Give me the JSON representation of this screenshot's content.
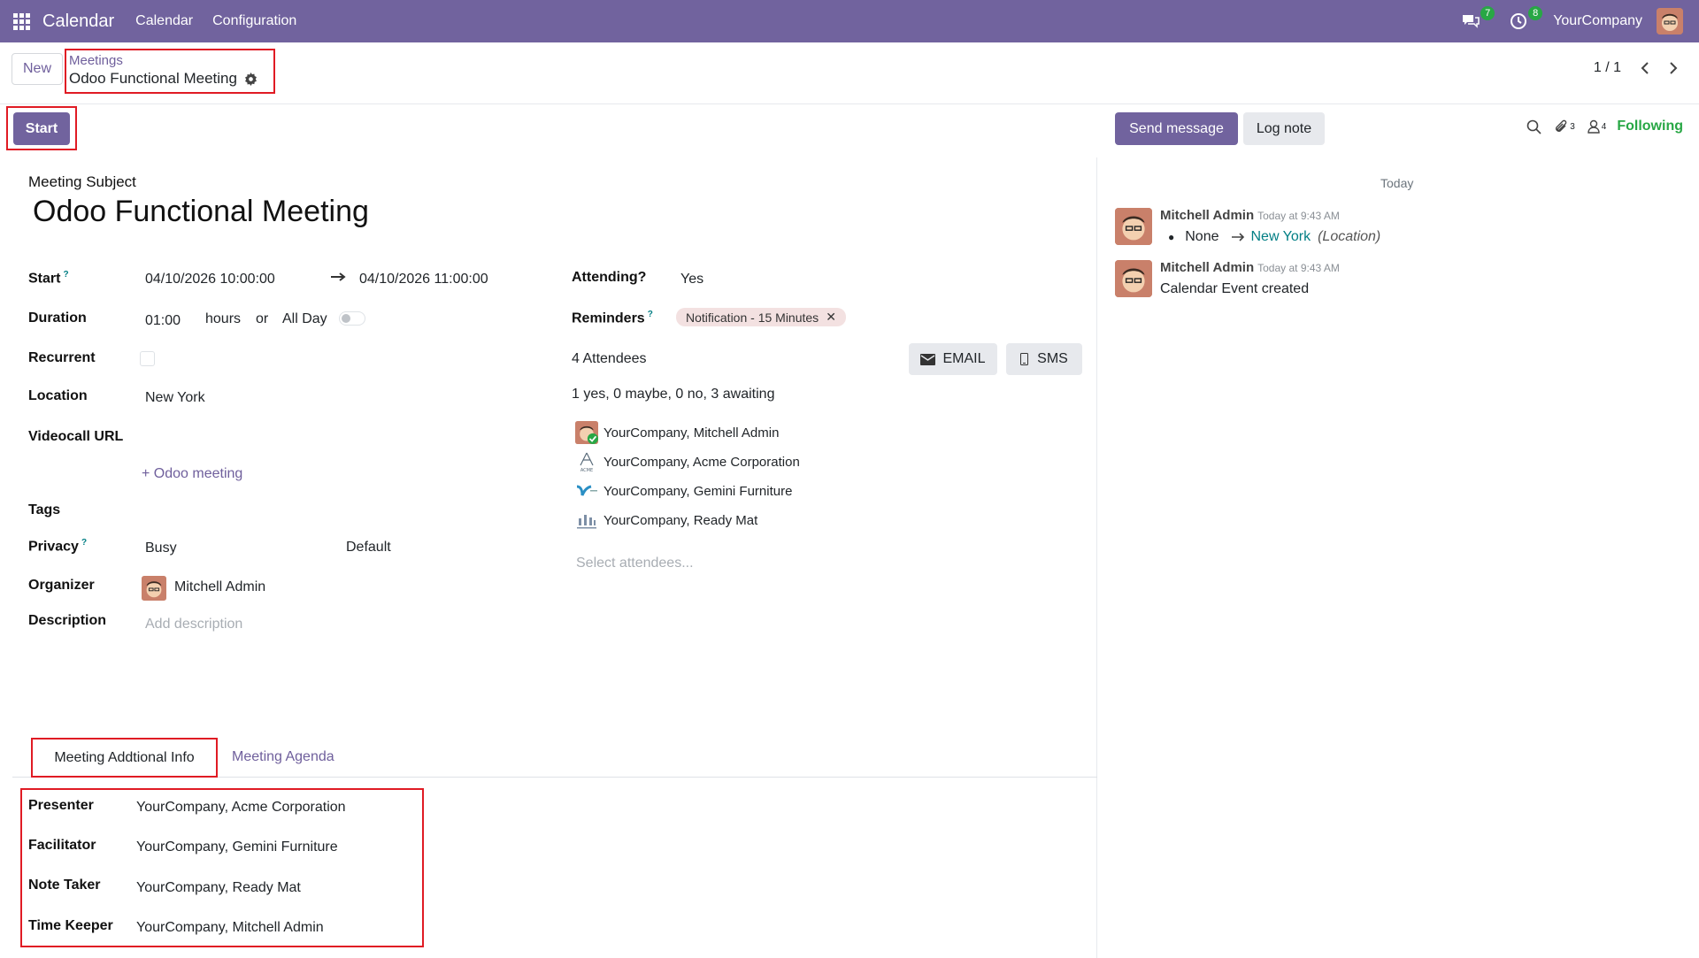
{
  "navbar": {
    "brand": "Calendar",
    "menu": [
      "Calendar",
      "Configuration"
    ],
    "messages_count": "7",
    "activities_count": "8",
    "company": "YourCompany"
  },
  "control_panel": {
    "new_label": "New",
    "breadcrumb_parent": "Meetings",
    "breadcrumb_current": "Odoo Functional Meeting",
    "pager": "1 / 1"
  },
  "statusbar": {
    "start_label": "Start"
  },
  "form": {
    "subject_label": "Meeting Subject",
    "subject": "Odoo Functional Meeting",
    "start_label": "Start",
    "help_mark": "?",
    "start": "04/10/2026 10:00:00",
    "stop": "04/10/2026 11:00:00",
    "duration_label": "Duration",
    "duration": "01:00",
    "hours": "hours",
    "or": "or",
    "all_day": "All Day",
    "recurrent_label": "Recurrent",
    "location_label": "Location",
    "location": "New York",
    "videocall_label": "Videocall URL",
    "odoo_meeting": "Odoo meeting",
    "tags_label": "Tags",
    "privacy_label": "Privacy",
    "privacy_show_as": "Busy",
    "privacy": "Default",
    "organizer_label": "Organizer",
    "organizer": "Mitchell Admin",
    "description_label": "Description",
    "description_placeholder": "Add description",
    "attending_label": "Attending?",
    "attending": "Yes",
    "reminders_label": "Reminders",
    "reminder_tag": "Notification - 15 Minutes",
    "attendees_count": "4 Attendees",
    "email_label": "EMAIL",
    "sms_label": "SMS",
    "attendees_summary": "1 yes, 0 maybe, 0 no, 3 awaiting",
    "attendees": [
      "YourCompany, Mitchell Admin",
      "YourCompany, Acme Corporation",
      "YourCompany, Gemini Furniture",
      "YourCompany, Ready Mat"
    ],
    "select_attendees_placeholder": "Select attendees..."
  },
  "tabs": {
    "tab1": "Meeting Addtional Info",
    "tab2": "Meeting Agenda"
  },
  "additional_info": {
    "presenter_label": "Presenter",
    "presenter": "YourCompany, Acme Corporation",
    "facilitator_label": "Facilitator",
    "facilitator": "YourCompany, Gemini Furniture",
    "note_taker_label": "Note Taker",
    "note_taker": "YourCompany, Ready Mat",
    "time_keeper_label": "Time Keeper",
    "time_keeper": "YourCompany, Mitchell Admin"
  },
  "chatter": {
    "send_message": "Send message",
    "log_note": "Log note",
    "attachments_count": "3",
    "followers_count": "4",
    "following": "Following",
    "today": "Today",
    "messages": [
      {
        "author": "Mitchell Admin",
        "date": "Today at 9:43 AM",
        "old_value": "None",
        "new_value": "New York",
        "field": "(Location)"
      },
      {
        "author": "Mitchell Admin",
        "date": "Today at 9:43 AM",
        "body": "Calendar Event created"
      }
    ]
  },
  "colors": {
    "brand": "#71639e",
    "highlight_box": "#e01b24",
    "following": "#28a745"
  }
}
